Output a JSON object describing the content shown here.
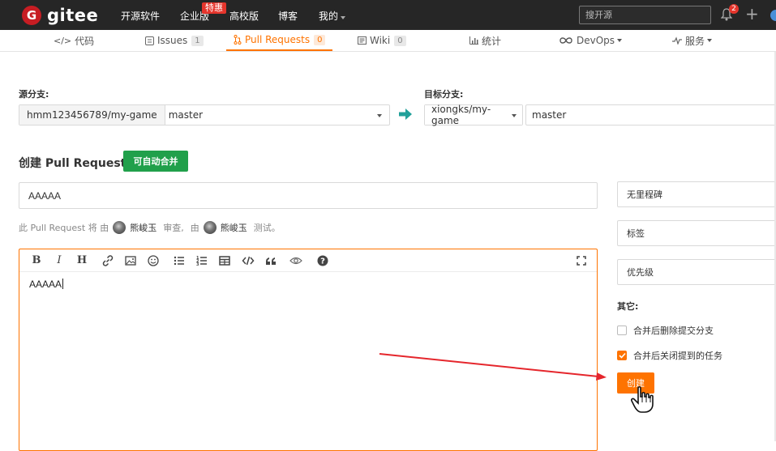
{
  "topnav": {
    "brand": "gitee",
    "logo_letter": "G",
    "links": [
      "开源软件",
      "企业版",
      "高校版",
      "博客",
      "我的"
    ],
    "promo_badge": "特惠",
    "search_placeholder": "搜开源",
    "notification_count": "2"
  },
  "tabs": [
    {
      "label": "代码",
      "icon": "code-icon"
    },
    {
      "label": "Issues",
      "count": "1",
      "icon": "issues-icon"
    },
    {
      "label": "Pull Requests",
      "count": "0",
      "icon": "pull-request-icon",
      "active": true
    },
    {
      "label": "Wiki",
      "count": "0",
      "icon": "wiki-icon"
    },
    {
      "label": "统计",
      "icon": "stats-icon"
    },
    {
      "label": "DevOps",
      "icon": "devops-icon"
    },
    {
      "label": "服务",
      "icon": "service-icon"
    }
  ],
  "source": {
    "label": "源分支:",
    "repo": "hmm123456789/my-game",
    "branch": "master"
  },
  "target": {
    "label": "目标分支:",
    "repo": "xiongks/my-game",
    "branch": "master"
  },
  "create": {
    "title": "创建 Pull Request",
    "merge_status": "可自动合并",
    "title_value": "AAAAA",
    "body_value": "AAAAA"
  },
  "reviewers": {
    "prefix": "此 Pull Request 将 由",
    "reviewer": "熊峻玉",
    "review_text": "审查,",
    "by": "由",
    "tester": "熊峻玉",
    "test_text": "测试。"
  },
  "sidebar": {
    "milestone": "无里程碑",
    "labels": "标签",
    "priority": "优先级",
    "other_label": "其它:",
    "delete_branch": "合并后删除提交分支",
    "delete_branch_checked": false,
    "close_issues": "合并后关闭提到的任务",
    "close_issues_checked": true,
    "create_button": "创建"
  },
  "colors": {
    "accent": "#fe7300",
    "nav_bg": "#262626",
    "merge_green": "#21a04b",
    "arrow_red": "#e5262c"
  }
}
